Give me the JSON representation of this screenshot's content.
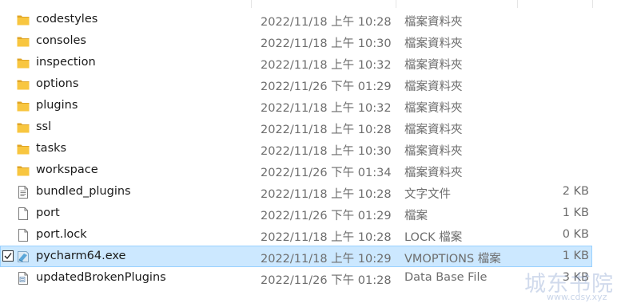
{
  "files": [
    {
      "name": "codestyles",
      "date": "2022/11/18 上午 10:28",
      "type": "檔案資料夾",
      "size": "",
      "icon": "folder-icon",
      "selected": false
    },
    {
      "name": "consoles",
      "date": "2022/11/18 上午 10:30",
      "type": "檔案資料夾",
      "size": "",
      "icon": "folder-icon",
      "selected": false
    },
    {
      "name": "inspection",
      "date": "2022/11/18 上午 10:32",
      "type": "檔案資料夾",
      "size": "",
      "icon": "folder-icon",
      "selected": false
    },
    {
      "name": "options",
      "date": "2022/11/26 下午 01:29",
      "type": "檔案資料夾",
      "size": "",
      "icon": "folder-icon",
      "selected": false
    },
    {
      "name": "plugins",
      "date": "2022/11/18 上午 10:32",
      "type": "檔案資料夾",
      "size": "",
      "icon": "folder-icon",
      "selected": false
    },
    {
      "name": "ssl",
      "date": "2022/11/18 上午 10:28",
      "type": "檔案資料夾",
      "size": "",
      "icon": "folder-icon",
      "selected": false
    },
    {
      "name": "tasks",
      "date": "2022/11/18 上午 10:30",
      "type": "檔案資料夾",
      "size": "",
      "icon": "folder-icon",
      "selected": false
    },
    {
      "name": "workspace",
      "date": "2022/11/26 下午 01:34",
      "type": "檔案資料夾",
      "size": "",
      "icon": "folder-icon",
      "selected": false
    },
    {
      "name": "bundled_plugins",
      "date": "2022/11/18 上午 10:28",
      "type": "文字文件",
      "size": "2 KB",
      "icon": "text-file-icon",
      "selected": false
    },
    {
      "name": "port",
      "date": "2022/11/26 下午 01:29",
      "type": "檔案",
      "size": "1 KB",
      "icon": "file-icon",
      "selected": false
    },
    {
      "name": "port.lock",
      "date": "2022/11/18 上午 10:28",
      "type": "LOCK 檔案",
      "size": "0 KB",
      "icon": "file-icon",
      "selected": false
    },
    {
      "name": "pycharm64.exe",
      "date": "2022/11/18 上午 10:29",
      "type": "VMOPTIONS 檔案",
      "size": "1 KB",
      "icon": "vmoptions-file-icon",
      "selected": true
    },
    {
      "name": "updatedBrokenPlugins",
      "date": "2022/11/26 下午 01:28",
      "type": "Data Base File",
      "size": "3 KB",
      "icon": "database-file-icon",
      "selected": false
    }
  ],
  "watermark": {
    "text": "城东书院",
    "url": "www.cdsy.xyz"
  },
  "colors": {
    "folder": "#f8c640",
    "selection_bg": "#cce8ff",
    "selection_border": "#99d1ff",
    "secondary_text": "#6d6d6d"
  }
}
